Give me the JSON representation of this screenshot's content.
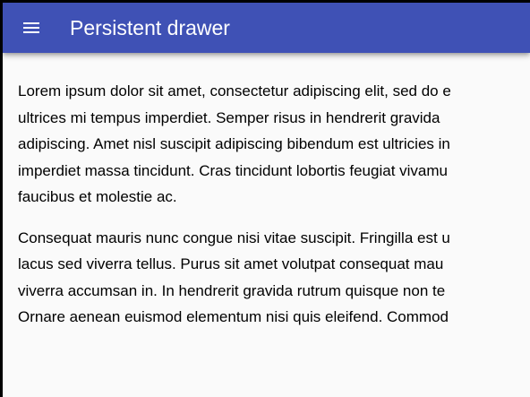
{
  "app_bar": {
    "title": "Persistent drawer",
    "menu_icon": "menu-icon",
    "background": "#3f51b5"
  },
  "main": {
    "paragraphs": [
      {
        "lines": [
          "Lorem ipsum dolor sit amet, consectetur adipiscing elit, sed do e",
          "ultrices mi tempus imperdiet. Semper risus in hendrerit gravida",
          "adipiscing. Amet nisl suscipit adipiscing bibendum est ultricies in",
          "imperdiet massa tincidunt. Cras tincidunt lobortis feugiat vivamu",
          "faucibus et molestie ac."
        ]
      },
      {
        "lines": [
          "Consequat mauris nunc congue nisi vitae suscipit. Fringilla est u",
          "lacus sed viverra tellus. Purus sit amet volutpat consequat mau",
          "viverra accumsan in. In hendrerit gravida rutrum quisque non te",
          "Ornare aenean euismod elementum nisi quis eleifend. Commod"
        ]
      }
    ]
  }
}
